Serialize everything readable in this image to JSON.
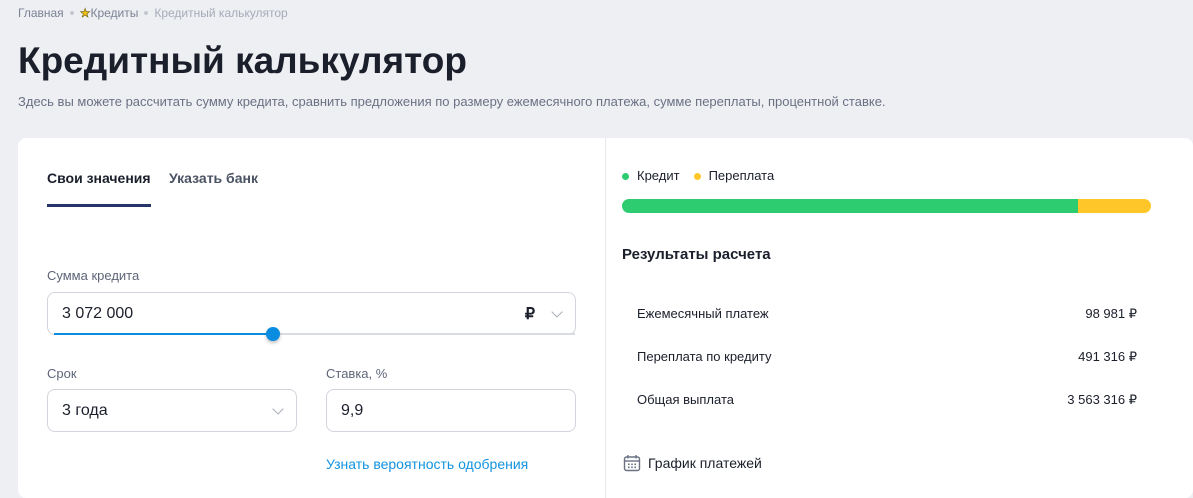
{
  "breadcrumb": {
    "home": "Главная",
    "credits": "Кредиты",
    "current": "Кредитный калькулятор"
  },
  "title": "Кредитный калькулятор",
  "description": "Здесь вы можете рассчитать сумму кредита, сравнить предложения по размеру ежемесячного платежа, сумме переплаты, процентной ставке.",
  "tabs": [
    {
      "label": "Свои значения"
    },
    {
      "label": "Указать банк"
    }
  ],
  "form": {
    "amount_label": "Сумма кредита",
    "amount_value": "3 072 000",
    "currency": "₽",
    "amount_slider_percent": 42,
    "term_label": "Срок",
    "term_value": "3 года",
    "rate_label": "Ставка, %",
    "rate_value": "9,9",
    "approval_link": "Узнать вероятность одобрения"
  },
  "chart": {
    "legend": [
      {
        "label": "Кредит",
        "color": "#2ecc71"
      },
      {
        "label": "Переплата",
        "color": "#ffc629"
      }
    ],
    "credit_percent": 86.2
  },
  "results": {
    "title": "Результаты расчета",
    "rows": [
      {
        "label": "Ежемесячный платеж",
        "value": "98 981 ₽"
      },
      {
        "label": "Переплата по кредиту",
        "value": "491 316 ₽"
      },
      {
        "label": "Общая выплата",
        "value": "3 563 316 ₽"
      }
    ],
    "schedule_label": "График платежей"
  }
}
